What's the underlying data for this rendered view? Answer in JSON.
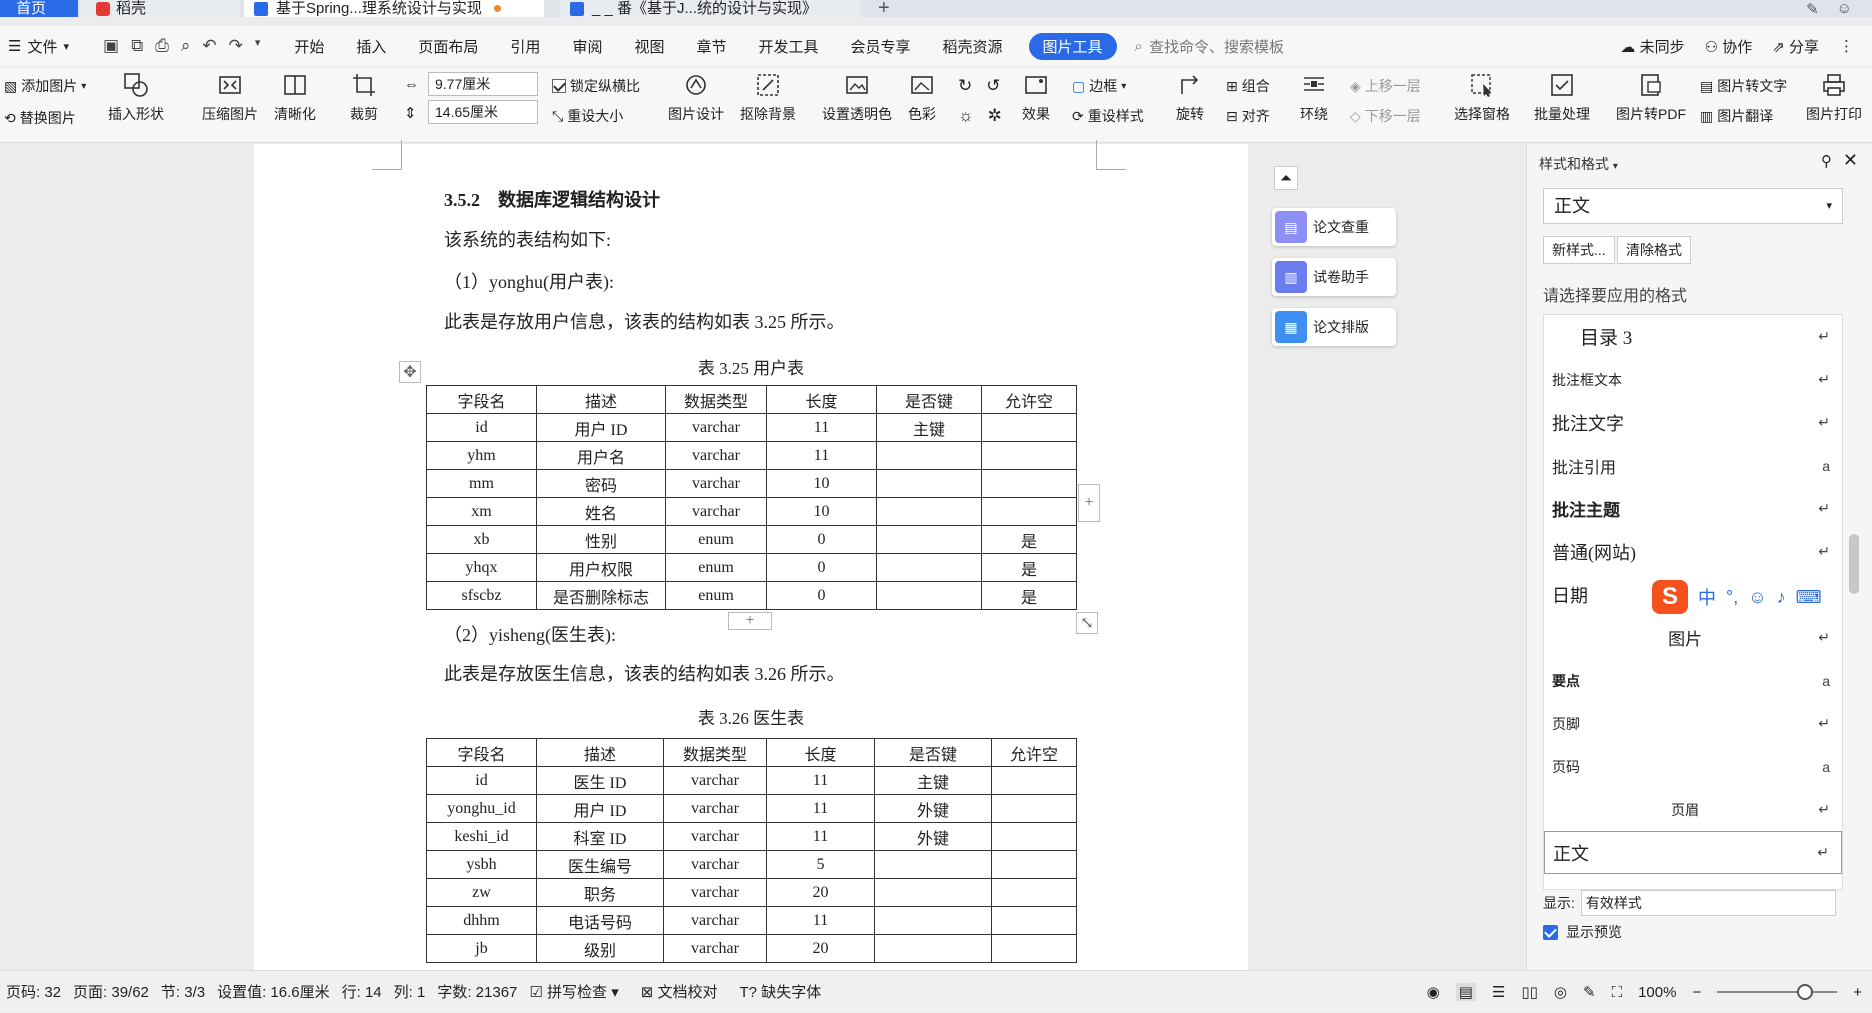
{
  "tabs": {
    "home": "首页",
    "daoke": "稻壳",
    "doc1": "基于Spring...理系统设计与实现",
    "doc2": "_ _ 番《基于J...统的设计与实现》"
  },
  "menu": {
    "file": "文件",
    "items": [
      "开始",
      "插入",
      "页面布局",
      "引用",
      "审阅",
      "视图",
      "章节",
      "开发工具",
      "会员专享",
      "稻壳资源"
    ],
    "picture_tool": "图片工具",
    "search_placeholder": "查找命令、搜索模板",
    "sync": "未同步",
    "collab": "协作",
    "share": "分享"
  },
  "ribbon": {
    "add_picture": "添加图片",
    "replace_picture": "替换图片",
    "insert_shape": "插入形状",
    "compress": "压缩图片",
    "clarify": "清晰化",
    "crop": "裁剪",
    "width": "9.77厘米",
    "height": "14.65厘米",
    "lock_ratio": "锁定纵横比",
    "reset_size": "重设大小",
    "picture_design": "图片设计",
    "remove_bg": "抠除背景",
    "set_transparent": "设置透明色",
    "color": "色彩",
    "effects": "效果",
    "border": "边框",
    "reset_style": "重设样式",
    "rotate": "旋转",
    "group": "组合",
    "align": "对齐",
    "wrap": "环绕",
    "bring_forward": "上移一层",
    "send_backward": "下移一层",
    "selection_pane": "选择窗格",
    "batch": "批量处理",
    "to_pdf": "图片转PDF",
    "to_text": "图片转文字",
    "translate": "图片翻译",
    "print": "图片打印"
  },
  "doc": {
    "heading": "3.5.2　数据库逻辑结构设计",
    "p1": "该系统的表结构如下:",
    "p2": "（1）yonghu(用户表):",
    "p3": "此表是存放用户信息，该表的结构如表 3.25 所示。",
    "caption1": "表 3.25  用户表",
    "p4": "（2）yisheng(医生表):",
    "p5": "此表是存放医生信息，该表的结构如表 3.26 所示。",
    "caption2": "表 3.26  医生表",
    "table1": {
      "header": [
        "字段名",
        "描述",
        "数据类型",
        "长度",
        "是否键",
        "允许空"
      ],
      "rows": [
        [
          "id",
          "用户 ID",
          "varchar",
          "11",
          "主键",
          ""
        ],
        [
          "yhm",
          "用户名",
          "varchar",
          "11",
          "",
          ""
        ],
        [
          "mm",
          "密码",
          "varchar",
          "10",
          "",
          ""
        ],
        [
          "xm",
          "姓名",
          "varchar",
          "10",
          "",
          ""
        ],
        [
          "xb",
          "性别",
          "enum",
          "0",
          "",
          "是"
        ],
        [
          "yhqx",
          "用户权限",
          "enum",
          "0",
          "",
          "是"
        ],
        [
          "sfscbz",
          "是否删除标志",
          "enum",
          "0",
          "",
          "是"
        ]
      ]
    },
    "table2": {
      "header": [
        "字段名",
        "描述",
        "数据类型",
        "长度",
        "是否键",
        "允许空"
      ],
      "rows": [
        [
          "id",
          "医生 ID",
          "varchar",
          "11",
          "主键",
          ""
        ],
        [
          "yonghu_id",
          "用户 ID",
          "varchar",
          "11",
          "外键",
          ""
        ],
        [
          "keshi_id",
          "科室 ID",
          "varchar",
          "11",
          "外键",
          ""
        ],
        [
          "ysbh",
          "医生编号",
          "varchar",
          "5",
          "",
          ""
        ],
        [
          "zw",
          "职务",
          "varchar",
          "20",
          "",
          ""
        ],
        [
          "dhhm",
          "电话号码",
          "varchar",
          "11",
          "",
          ""
        ],
        [
          "jb",
          "级别",
          "varchar",
          "20",
          "",
          ""
        ]
      ]
    }
  },
  "sidetools": [
    "论文查重",
    "试卷助手",
    "论文排版"
  ],
  "panel": {
    "title": "样式和格式",
    "current_style": "正文",
    "new_style": "新样式...",
    "clear_format": "清除格式",
    "apply_label": "请选择要应用的格式",
    "styles": [
      {
        "label": "目录 3",
        "mark": "↵"
      },
      {
        "label": "批注框文本",
        "mark": "↵"
      },
      {
        "label": "批注文字",
        "mark": "↵"
      },
      {
        "label": "批注引用",
        "mark": "a"
      },
      {
        "label": "批注主题",
        "mark": "↵"
      },
      {
        "label": "普通(网站)",
        "mark": "↵"
      },
      {
        "label": "日期",
        "mark": ""
      },
      {
        "label": "图片",
        "mark": "↵"
      },
      {
        "label": "要点",
        "mark": "a"
      },
      {
        "label": "页脚",
        "mark": "↵"
      },
      {
        "label": "页码",
        "mark": "a"
      },
      {
        "label": "页眉",
        "mark": "↵"
      },
      {
        "label": "正文",
        "mark": "↵"
      }
    ],
    "show_label": "显示:",
    "show_value": "有效样式",
    "preview_label": "显示预览"
  },
  "ime": {
    "logo": "S",
    "lang": "中"
  },
  "status": {
    "page_code": "页码: 32",
    "page": "页面: 39/62",
    "section": "节: 3/3",
    "setting": "设置值: 16.6厘米",
    "row": "行: 14",
    "col": "列: 1",
    "words": "字数: 21367",
    "spell": "拼写检查",
    "proof": "文档校对",
    "missing_font": "缺失字体",
    "zoom": "100%"
  },
  "colors": {
    "accent": "#2b6ae6",
    "sidetool_icon": "#8d8ff5"
  }
}
